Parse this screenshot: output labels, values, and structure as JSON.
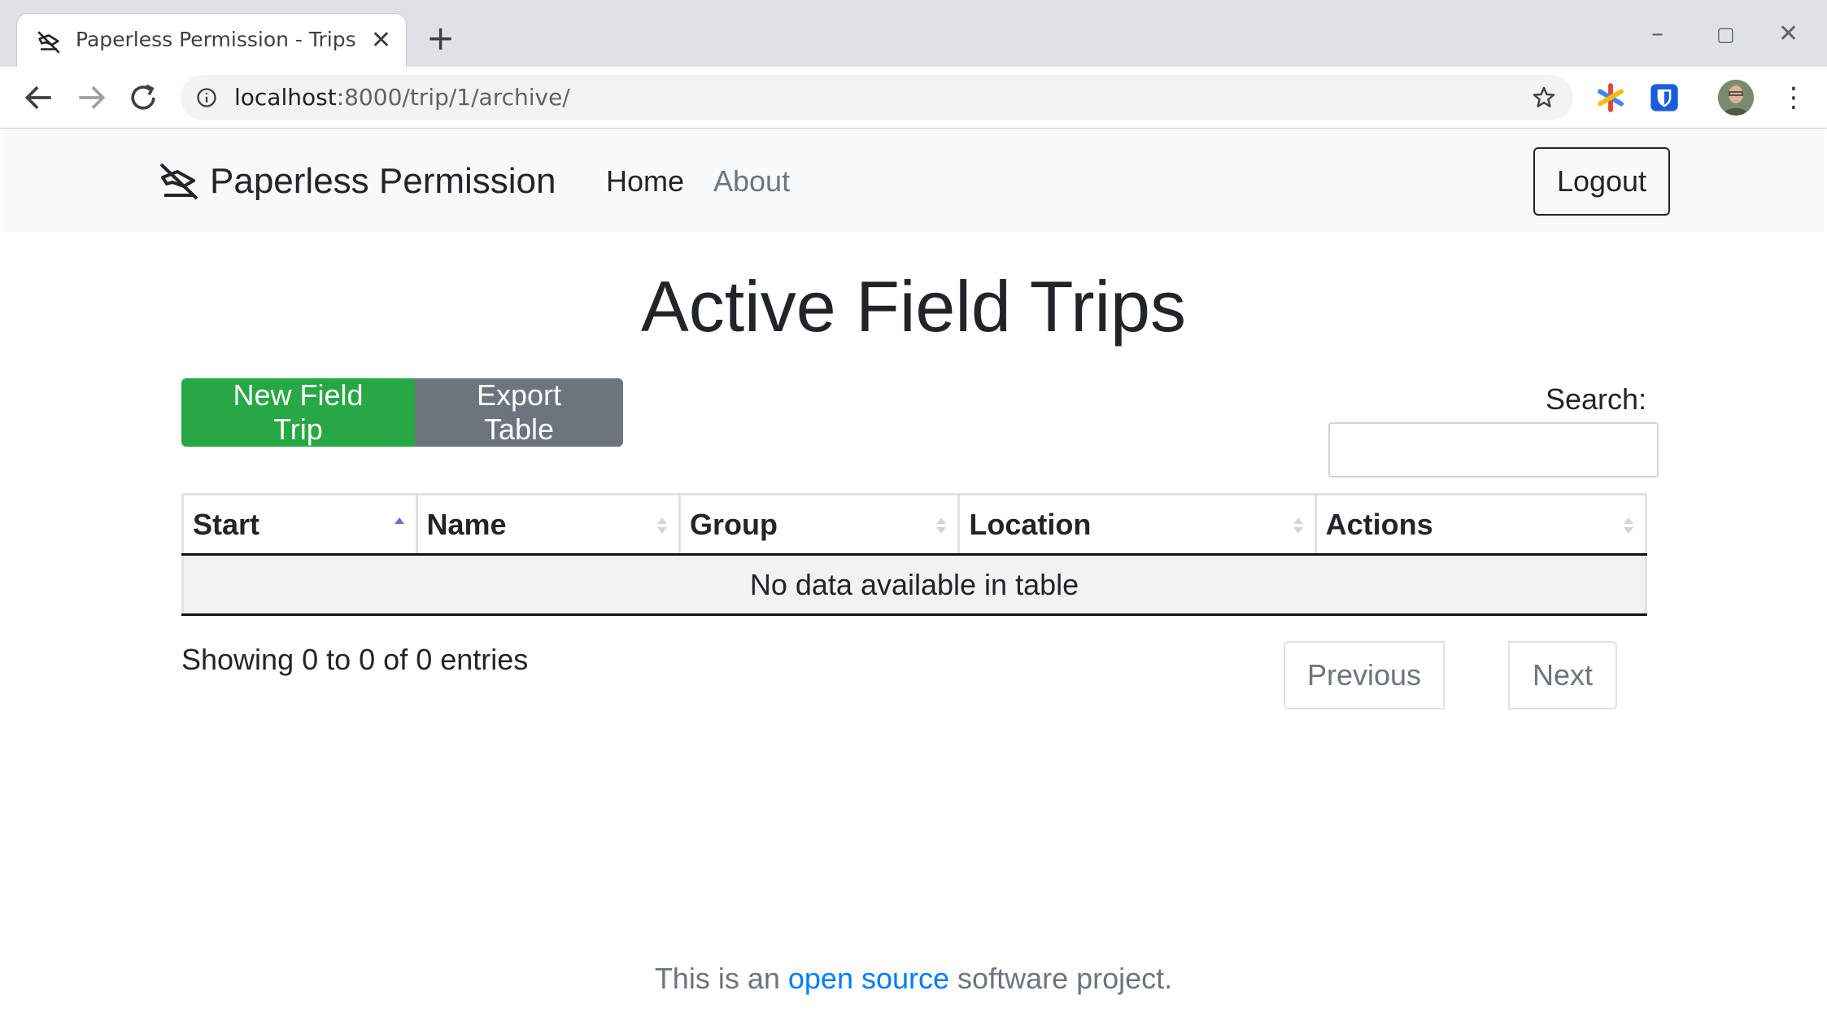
{
  "browser": {
    "tab_title": "Paperless Permission - Trips",
    "url_host": "localhost",
    "url_path": ":8000/trip/1/archive/",
    "new_tab_label": "+",
    "close_tab_label": "✕",
    "window_controls": {
      "minimize": "–",
      "maximize": "▢",
      "close": "✕"
    },
    "menu_label": "⋮"
  },
  "navbar": {
    "brand": "Paperless Permission",
    "links": [
      {
        "label": "Home"
      },
      {
        "label": "About"
      }
    ],
    "logout_label": "Logout"
  },
  "page_title": "Active Field Trips",
  "actions": {
    "new_trip_label": "New Field Trip",
    "export_label": "Export Table"
  },
  "search": {
    "label": "Search:",
    "value": "",
    "placeholder": ""
  },
  "table": {
    "columns": [
      {
        "label": "Start",
        "sort": "asc"
      },
      {
        "label": "Name",
        "sort": "none"
      },
      {
        "label": "Group",
        "sort": "none"
      },
      {
        "label": "Location",
        "sort": "none"
      },
      {
        "label": "Actions",
        "sort": "none"
      }
    ],
    "empty_message": "No data available in table"
  },
  "pagination": {
    "info": "Showing 0 to 0 of 0 entries",
    "previous_label": "Previous",
    "next_label": "Next"
  },
  "footer": {
    "prefix": "This is an",
    "link_text": "open source",
    "suffix": "software project."
  },
  "colors": {
    "success": "#28a745",
    "secondary": "#6c757d",
    "link": "#007bff",
    "navbar_bg": "#f8f9fa"
  }
}
